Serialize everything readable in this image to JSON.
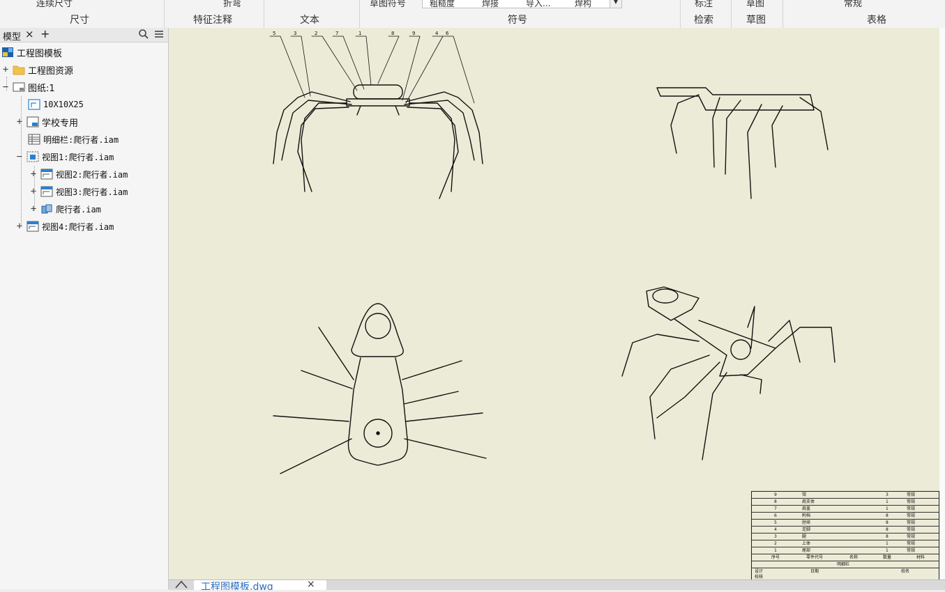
{
  "ribbon": {
    "top_labels": [
      "连续尺寸",
      "折弯",
      "粗糙度",
      "焊接",
      "导入...",
      "焊构",
      "标注",
      "草图",
      "常规"
    ],
    "groups": [
      "尺寸",
      "特征注释",
      "文本",
      "符号",
      "检索",
      "草图",
      "表格"
    ],
    "sketch_symbol_label": "草图符号"
  },
  "browser": {
    "tab_model": "模型",
    "tab_close": "×",
    "tab_add": "+",
    "items": [
      {
        "label": "工程图模板",
        "expander": "",
        "icon": "drawing-template-icon"
      },
      {
        "label": "工程图资源",
        "expander": "+",
        "icon": "folder-icon"
      },
      {
        "label": "图纸:1",
        "expander": "−",
        "icon": "sheet-icon"
      },
      {
        "label": "10X10X25",
        "expander": "",
        "icon": "border-icon"
      },
      {
        "label": "学校专用",
        "expander": "+",
        "icon": "titleblock-icon"
      },
      {
        "label": "明细栏:爬行者.iam",
        "expander": "",
        "icon": "parts-list-icon"
      },
      {
        "label": "视图1:爬行者.iam",
        "expander": "−",
        "icon": "base-view-icon"
      },
      {
        "label": "视图2:爬行者.iam",
        "expander": "+",
        "icon": "projected-view-icon"
      },
      {
        "label": "视图3:爬行者.iam",
        "expander": "+",
        "icon": "projected-view-icon"
      },
      {
        "label": "爬行者.iam",
        "expander": "+",
        "icon": "assembly-icon"
      },
      {
        "label": "视图4:爬行者.iam",
        "expander": "+",
        "icon": "projected-view-icon"
      }
    ]
  },
  "balloons": [
    "5",
    "3",
    "2",
    "7",
    "1",
    "8",
    "9",
    "4",
    "6"
  ],
  "parts_list": {
    "rows": [
      {
        "no": "9",
        "name": "钳",
        "qty": "3",
        "mat": "常规"
      },
      {
        "no": "8",
        "name": "肩支体",
        "qty": "1",
        "mat": "常规"
      },
      {
        "no": "7",
        "name": "肩盖",
        "qty": "1",
        "mat": "常规"
      },
      {
        "no": "6",
        "name": "附档",
        "qty": "8",
        "mat": "常规"
      },
      {
        "no": "5",
        "name": "肘续",
        "qty": "8",
        "mat": "常规"
      },
      {
        "no": "4",
        "name": "足脚",
        "qty": "8",
        "mat": "常规"
      },
      {
        "no": "3",
        "name": "腿",
        "qty": "8",
        "mat": "常规"
      },
      {
        "no": "2",
        "name": "上体",
        "qty": "1",
        "mat": "常规"
      },
      {
        "no": "1",
        "name": "尾部",
        "qty": "1",
        "mat": "常规"
      }
    ],
    "header": [
      "序号",
      "零件代号",
      "名称",
      "数量",
      "材料"
    ],
    "caption": "明细栏",
    "title_block": {
      "design": "设计",
      "check": "校核",
      "date": "日期",
      "school": "校名"
    }
  },
  "document_tab": {
    "label": "工程图模板.dwg",
    "close": "×"
  }
}
